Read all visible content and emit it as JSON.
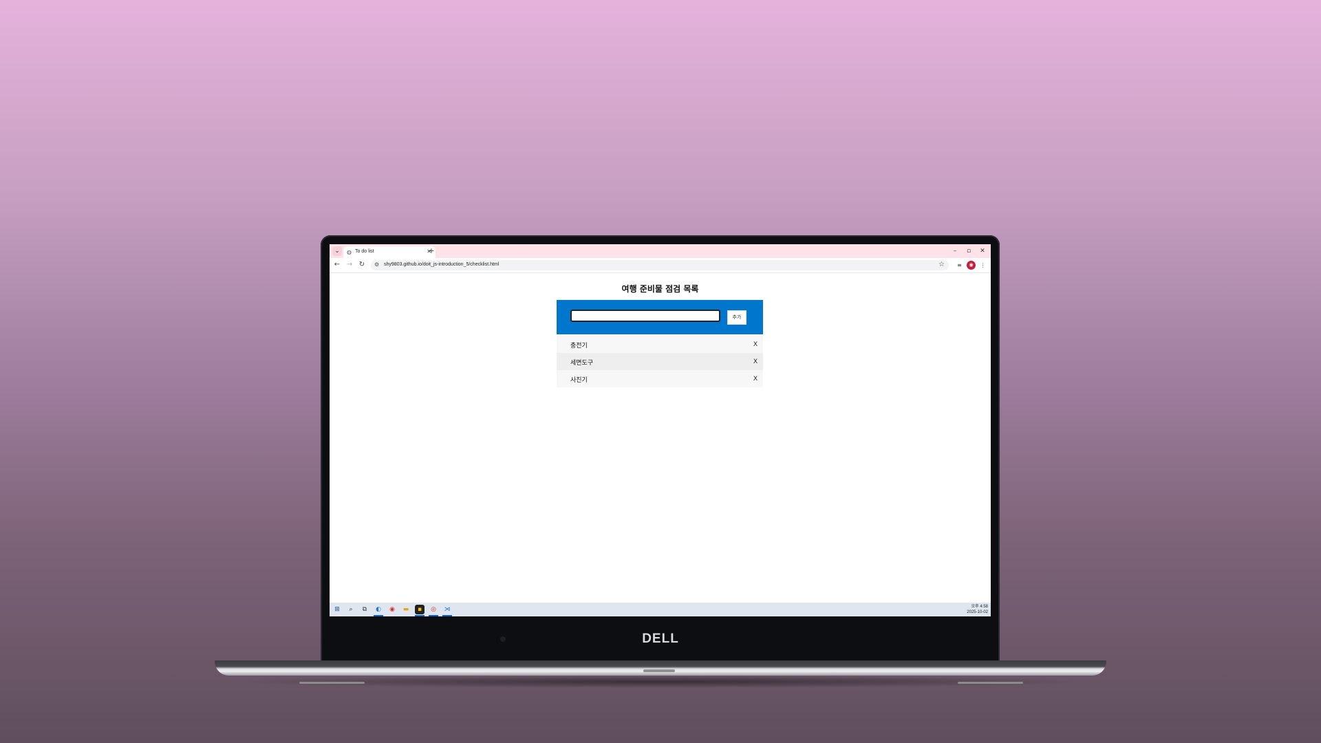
{
  "browser": {
    "tab_title": "To do list",
    "tab_close": "✕",
    "new_tab": "+",
    "window_controls": [
      "–",
      "▫",
      "✕"
    ],
    "url": "shy9803.github.io/doit_js-introduction_5/checklist.html"
  },
  "page": {
    "title": "여행 준비물 점검 목록",
    "input": {
      "value": "",
      "placeholder": ""
    },
    "add_button": "추가",
    "items": [
      {
        "label": "충전기",
        "delete": "X"
      },
      {
        "label": "세면도구",
        "delete": "X"
      },
      {
        "label": "사진기",
        "delete": "X"
      }
    ]
  },
  "taskbar": {
    "time": "오후 4:58",
    "date": "2025-10-02"
  },
  "device": {
    "brand": "DELL"
  },
  "colors": {
    "form_bg": "#0077cc",
    "tab_bar": "#fde2e7",
    "taskbar": "#dfe6ef"
  }
}
